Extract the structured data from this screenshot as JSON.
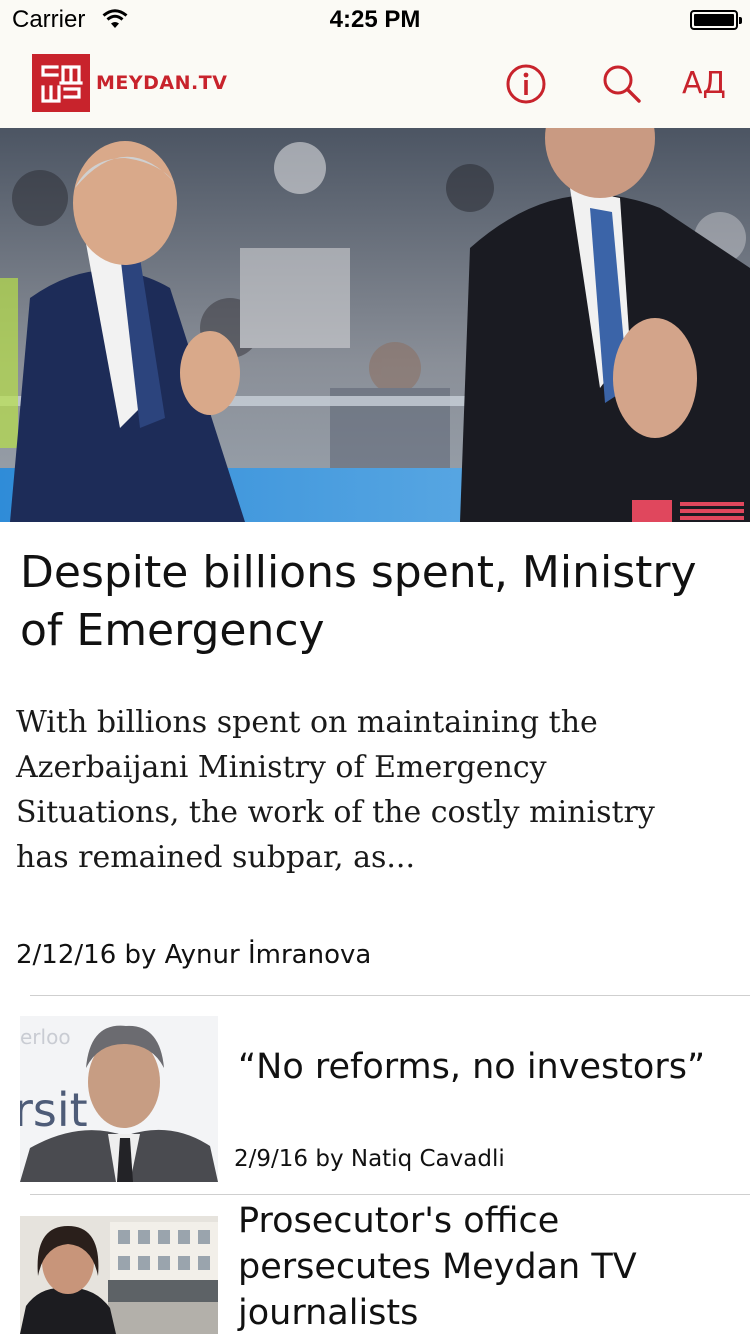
{
  "status_bar": {
    "carrier": "Carrier",
    "time": "4:25 PM"
  },
  "nav": {
    "logo_text": "MEYDAN.TV",
    "lang_label": "АД",
    "icons": [
      "info-icon",
      "search-icon"
    ],
    "accent_color": "#c8232c"
  },
  "featured": {
    "title": "Despite billions spent, Ministry of Emergency",
    "summary": "With billions spent on maintaining the Azerbaijani Ministry of Emergency Situations, the work of the costly ministry has remained subpar, as...",
    "meta": "2/12/16 by Aynur İmranova"
  },
  "articles": [
    {
      "title": "“No reforms, no investors”",
      "meta": "2/9/16 by Natiq Cavadli"
    },
    {
      "title": "Prosecutor's office persecutes Meydan TV journalists",
      "meta": ""
    }
  ]
}
